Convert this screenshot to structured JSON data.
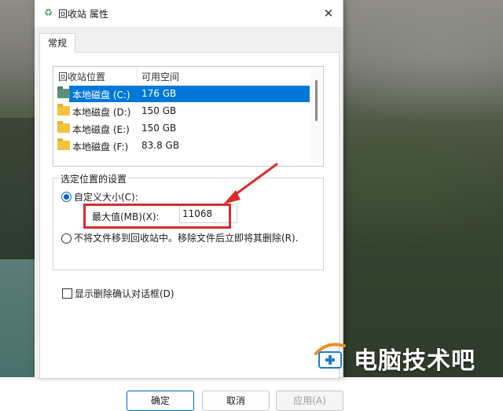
{
  "dialog": {
    "title": "回收站 属性",
    "close_glyph": "✕",
    "title_icon_glyph": "♻"
  },
  "tab": {
    "label": "常规"
  },
  "list": {
    "columns": [
      "回收站位置",
      "可用空间"
    ],
    "rows": [
      {
        "name": "本地磁盘 (C:)",
        "free": "176 GB",
        "selected": true
      },
      {
        "name": "本地磁盘 (D:)",
        "free": "150 GB",
        "selected": false
      },
      {
        "name": "本地磁盘 (E:)",
        "free": "150 GB",
        "selected": false
      },
      {
        "name": "本地磁盘 (F:)",
        "free": "83.8 GB",
        "selected": false
      }
    ]
  },
  "settings": {
    "group_title": "选定位置的设置",
    "custom_size_label": "自定义大小(C):",
    "max_label": "最大值(MB)(X):",
    "max_value": "11068",
    "no_recycle_label": "不将文件移到回收站中。移除文件后立即将其删除(R)."
  },
  "confirm_label": "显示删除确认对话框(D)",
  "buttons": {
    "ok": "确定",
    "cancel": "取消",
    "apply": "应用(A)"
  },
  "watermark": {
    "text": "电脑技术吧"
  },
  "colors": {
    "accent": "#0078d7",
    "highlight": "#d92c2c"
  }
}
